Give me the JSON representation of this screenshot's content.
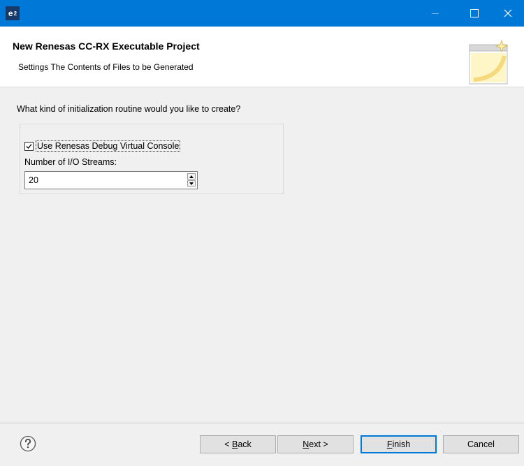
{
  "titlebar": {
    "logo_text": "e",
    "logo_sup": "2",
    "minimize": "minimize",
    "maximize": "maximize",
    "close": "close"
  },
  "header": {
    "title": "New Renesas CC-RX Executable Project",
    "subtitle": "Settings The Contents of Files to be Generated"
  },
  "content": {
    "question": "What kind of initialization routine would you like to create?",
    "debug_console": {
      "label": "Use Renesas Debug Virtual Console",
      "checked": true
    },
    "streams": {
      "label": "Number of I/O Streams:",
      "value": "20"
    }
  },
  "footer": {
    "help": "help-icon",
    "back": {
      "mnemonic": "B",
      "rest": "ack",
      "prefix": "< "
    },
    "next": {
      "mnemonic": "N",
      "rest": "ext >"
    },
    "finish": {
      "mnemonic": "F",
      "rest": "inish"
    },
    "cancel": "Cancel"
  },
  "colors": {
    "titlebar": "#0078d7",
    "content_bg": "#f0f0f0",
    "header_bg": "#ffffff",
    "default_button_border": "#0078d7"
  }
}
